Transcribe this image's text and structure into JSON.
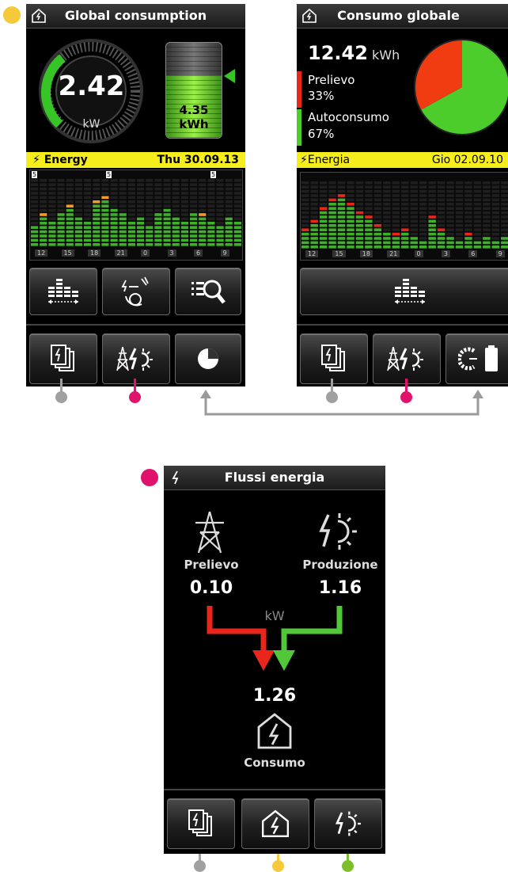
{
  "screen1": {
    "title": "Global consumption",
    "gauge_value": "2.42",
    "gauge_unit": "kW",
    "battery_value": "4.35",
    "battery_unit": "kWh",
    "energy_label": "Energy",
    "date": "Thu 30.09.13",
    "chart_markers": [
      "5",
      "5",
      "5"
    ],
    "chart_ticks": [
      "12",
      "15",
      "18",
      "21",
      "0",
      "3",
      "6",
      "9"
    ]
  },
  "screen2": {
    "title": "Consumo globale",
    "total_value": "12.42",
    "total_unit": "kWh",
    "prelievo_label": "Prelievo",
    "prelievo_pct": "33%",
    "autoconsumo_label": "Autoconsumo",
    "autoconsumo_pct": "67%",
    "energy_label": "Energia",
    "date": "Gio 02.09.10",
    "chart_ticks": [
      "12",
      "15",
      "18",
      "21",
      "0",
      "3",
      "6",
      "9"
    ]
  },
  "screen3": {
    "title": "Flussi energia",
    "grid_label": "Prelievo",
    "grid_value": "0.10",
    "prod_label": "Produzione",
    "prod_value": "1.16",
    "unit": "kW",
    "consumption_value": "1.26",
    "consumption_label": "Consumo"
  },
  "colors": {
    "yellow": "#f5ee1c",
    "magenta": "#e0126c",
    "gray": "#a0a0a0",
    "green": "#7cbf2a",
    "red": "#e8261c",
    "pie_green": "#4ccd2c",
    "pie_red": "#f03c10"
  },
  "pie": {
    "prelievo": 33,
    "autoconsumo": 67
  }
}
